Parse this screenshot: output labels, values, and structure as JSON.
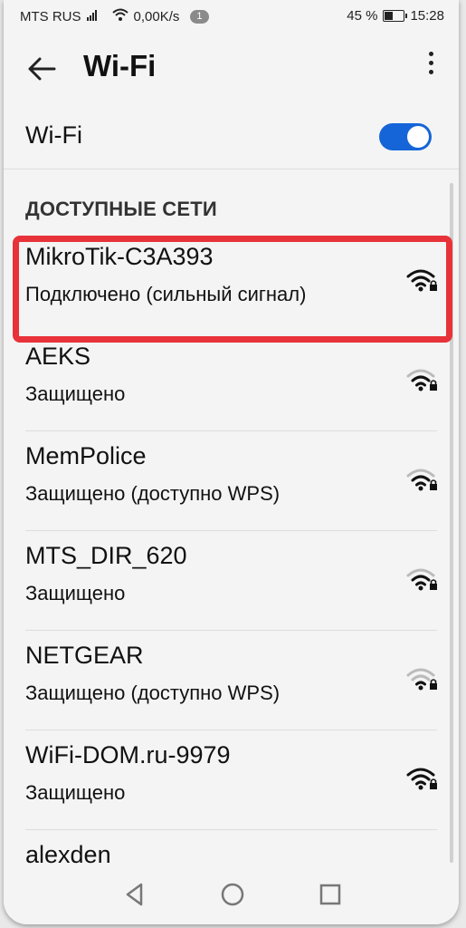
{
  "status_bar": {
    "carrier": "MTS RUS",
    "speed": "0,00K/s",
    "notification_count": "1",
    "battery": "45 %",
    "time": "15:28"
  },
  "app_bar": {
    "title": "Wi-Fi",
    "back_icon": "arrow-left-icon",
    "more_icon": "more-vert-icon"
  },
  "wifi_toggle": {
    "label": "Wi-Fi",
    "on": true
  },
  "section": {
    "title": "ДОСТУПНЫЕ СЕТИ"
  },
  "networks": [
    {
      "name": "MikroTik-C3A393",
      "status": "Подключено (сильный сигнал)"
    },
    {
      "name": "AEKS",
      "status": "Защищено"
    },
    {
      "name": "MemPolice",
      "status": "Защищено (доступно WPS)"
    },
    {
      "name": "MTS_DIR_620",
      "status": "Защищено"
    },
    {
      "name": "NETGEAR",
      "status": "Защищено (доступно WPS)"
    },
    {
      "name": "WiFi-DOM.ru-9979",
      "status": "Защищено"
    },
    {
      "name": "alexden",
      "status": ""
    }
  ],
  "colors": {
    "accent": "#1565d8",
    "highlight": "#e8323a"
  }
}
